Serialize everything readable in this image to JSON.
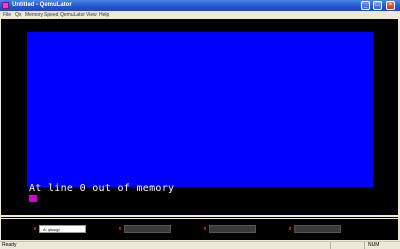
{
  "window": {
    "title": "Untitled - QemuLator",
    "controls": {
      "minimize": "_",
      "maximize": "□",
      "close": "×"
    }
  },
  "menu": {
    "items": [
      "File",
      "Qx",
      "Memory",
      "Speed",
      "QemuLator",
      "View",
      "Help"
    ]
  },
  "screen": {
    "text": "At line 0 out of memory",
    "paper_color": "#0000ff",
    "border_color": "#000000",
    "ink_color": "#ffffff",
    "cursor_color": "#d100d1"
  },
  "toolbar": {
    "fields": [
      {
        "value": "A: qlusqp",
        "active": true
      },
      {
        "value": "",
        "active": false
      },
      {
        "value": "",
        "active": false
      },
      {
        "value": "",
        "active": false
      }
    ]
  },
  "statusbar": {
    "status_text": "Ready",
    "indicator": "NUM"
  }
}
